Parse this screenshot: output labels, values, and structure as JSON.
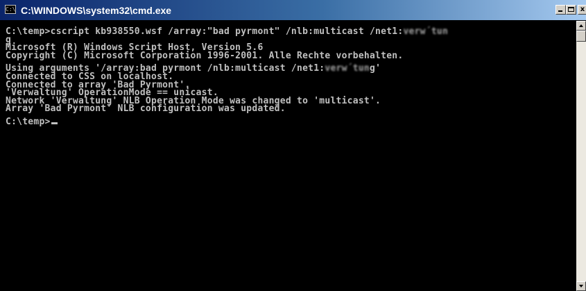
{
  "window": {
    "title": "C:\\WINDOWS\\system32\\cmd.exe",
    "icon": "cmd-console-icon",
    "icon_glyph": "C:\\",
    "minimize_label": "",
    "maximize_label": "",
    "close_label": "x"
  },
  "colors": {
    "console_background": "#000000",
    "console_text": "#c0c0c0",
    "titlebar_start": "#0a246a",
    "titlebar_end": "#a6caf0"
  },
  "console": {
    "command_prefix": "C:\\temp>cscript kb938550.wsf /array:\"bad pyrmont\" /nlb:multicast /net1:",
    "command_redacted": "verw´tun",
    "command_wrap": "g",
    "host_line1": "Microsoft (R) Windows Script Host, Version 5.6",
    "host_line2": "Copyright (C) Microsoft Corporation 1996-2001. Alle Rechte vorbehalten.",
    "args_prefix": "Using arguments '/array:bad pyrmont /nlb:multicast /net1:",
    "args_redacted": "verw´tun",
    "args_suffix": "g'",
    "output": [
      "Connected to CSS on localhost.",
      "Connected to array 'Bad Pyrmont'.",
      "'Verwaltung' OperationMode == unicast.",
      "Network 'Verwaltung' NLB Operation Mode was changed to 'multicast'.",
      "Array 'Bad Pyrmont' NLB configuration was updated."
    ],
    "prompt": "C:\\temp>"
  }
}
